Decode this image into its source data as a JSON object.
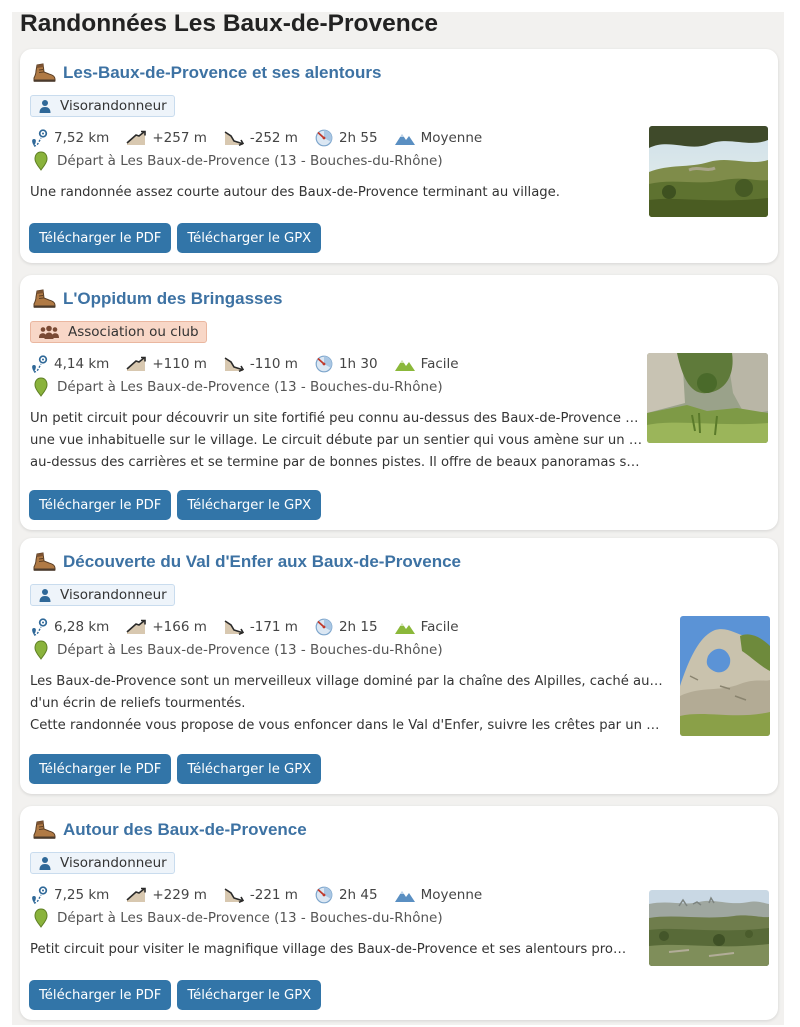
{
  "page": {
    "title": "Randonnées Les Baux-de-Provence"
  },
  "buttons": {
    "pdf": "Télécharger le PDF",
    "gpx": "Télécharger le GPX"
  },
  "cards": [
    {
      "title": "Les-Baux-de-Provence et ses alentours",
      "badge": "Visorandonneur",
      "distance": "7,52 km",
      "ascent": "+257 m",
      "descent": "-252 m",
      "duration": "2h 55",
      "difficulty": "Moyenne",
      "depart": "Départ à Les Baux-de-Provence (13 - Bouches-du-Rhône)",
      "desc": [
        "Une randonnée assez courte autour des Baux-de-Provence terminant au village."
      ]
    },
    {
      "title": "L'Oppidum des Bringasses",
      "badge": "Association ou club",
      "distance": "4,14 km",
      "ascent": "+110 m",
      "descent": "-110 m",
      "duration": "1h 30",
      "difficulty": "Facile",
      "depart": "Départ à Les Baux-de-Provence (13 - Bouches-du-Rhône)",
      "desc": [
        "Un petit circuit pour découvrir un site fortifié peu connu au-dessus des Baux-de-Provence avec",
        "une vue inhabituelle sur le village. Le circuit débute par un sentier qui vous amène sur un plateau",
        "au-dessus des carrières et se termine par de bonnes pistes. Il offre de beaux panoramas sur le Su…"
      ]
    },
    {
      "title": "Découverte du Val d'Enfer aux Baux-de-Provence",
      "badge": "Visorandonneur",
      "distance": "6,28 km",
      "ascent": "+166 m",
      "descent": "-171 m",
      "duration": "2h 15",
      "difficulty": "Facile",
      "depart": "Départ à Les Baux-de-Provence (13 - Bouches-du-Rhône)",
      "desc": [
        "Les Baux-de-Provence sont un merveilleux village dominé par la chaîne des Alpilles, caché au milieu",
        "d'un écrin de reliefs tourmentés.",
        "Cette randonnée vous propose de vous enfoncer dans le Val d'Enfer, suivre les crêtes par un chemin…"
      ]
    },
    {
      "title": "Autour des Baux-de-Provence",
      "badge": "Visorandonneur",
      "distance": "7,25 km",
      "ascent": "+229 m",
      "descent": "-221 m",
      "duration": "2h 45",
      "difficulty": "Moyenne",
      "depart": "Départ à Les Baux-de-Provence (13 - Bouches-du-Rhône)",
      "desc": [
        "Petit circuit pour visiter le magnifique village des Baux-de-Provence et ses alentours proches."
      ]
    }
  ],
  "colors": {
    "title": "#3d72a3",
    "button": "#3275a8",
    "moyenne": "#5a8fc2",
    "facile": "#8bb83a",
    "pin": "#8ab33c"
  },
  "icons": [
    "hiking-boot-icon",
    "user-icon",
    "group-icon",
    "distance-icon",
    "ascent-icon",
    "descent-icon",
    "duration-icon",
    "mountain-icon",
    "location-pin-icon"
  ]
}
